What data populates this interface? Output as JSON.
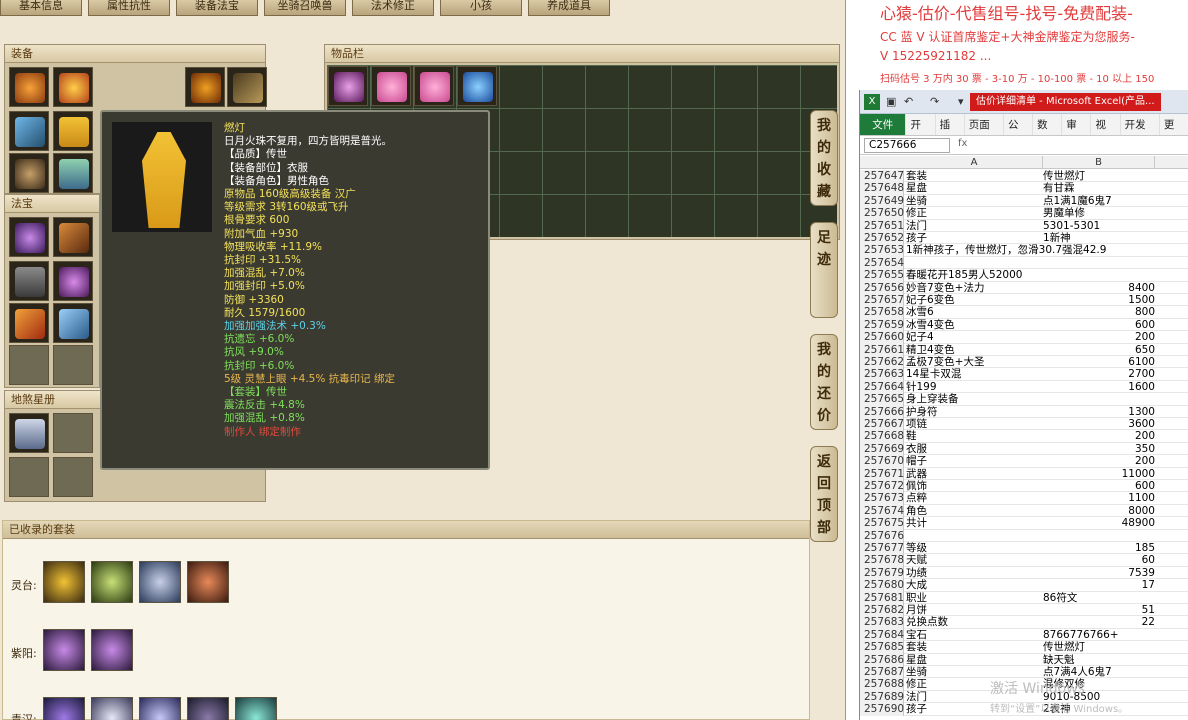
{
  "game": {
    "tabs": [
      "基本信息",
      "属性抗性",
      "装备法宝",
      "坐骑召唤兽",
      "法术修正",
      "小孩",
      "养成道具"
    ],
    "panels": {
      "equip": "装备",
      "fabao": "法宝",
      "stars": "地煞星册",
      "items": "物品栏",
      "collected": "已收录的套装"
    },
    "side_buttons": [
      [
        "我",
        "的",
        "收",
        "藏"
      ],
      [
        "足",
        "迹"
      ],
      [
        "我",
        "的",
        "还",
        "价"
      ],
      [
        "返",
        "回",
        "顶",
        "部"
      ]
    ],
    "collect_rows": [
      "灵台:",
      "紫阳:",
      "青汉:"
    ]
  },
  "tooltip": {
    "lines": [
      {
        "t": "燃灯",
        "c": "l-yellow"
      },
      {
        "t": "日月火珠不复用，四方皆明是普光。",
        "c": "l-white"
      },
      {
        "t": "【品质】传世",
        "c": "l-white"
      },
      {
        "t": "【装备部位】衣服",
        "c": "l-white"
      },
      {
        "t": "【装备角色】男性角色",
        "c": "l-white"
      },
      {
        "t": "原物品 160级高级装备 汉广",
        "c": "l-yellow"
      },
      {
        "t": "等级需求 3转160级或飞升",
        "c": "l-yellow"
      },
      {
        "t": "根骨要求 600",
        "c": "l-yellow"
      },
      {
        "t": "附加气血 +930",
        "c": "l-yellow"
      },
      {
        "t": "物理吸收率 +11.9%",
        "c": "l-yellow"
      },
      {
        "t": "抗封印 +31.5%",
        "c": "l-yellow"
      },
      {
        "t": "加强混乱 +7.0%",
        "c": "l-yellow"
      },
      {
        "t": "加强封印 +5.0%",
        "c": "l-yellow"
      },
      {
        "t": "防御 +3360",
        "c": "l-yellow"
      },
      {
        "t": "耐久 1579/1600",
        "c": "l-yellow"
      },
      {
        "t": "加强加强法术 +0.3%",
        "c": "l-cyan"
      },
      {
        "t": "抗遗忘 +6.0%",
        "c": "l-green"
      },
      {
        "t": "抗风 +9.0%",
        "c": "l-green"
      },
      {
        "t": "抗封印 +6.0%",
        "c": "l-green"
      },
      {
        "t": "5级 灵慧上眼 +4.5% 抗毒印记 绑定",
        "c": "l-gold"
      },
      {
        "t": " ",
        "c": "l-white"
      },
      {
        "t": "【套装】传世",
        "c": "l-green"
      },
      {
        "t": "震法反击 +4.8%",
        "c": "l-green"
      },
      {
        "t": "加强混乱 +0.8%",
        "c": "l-green"
      },
      {
        "t": "制作人 绑定制作",
        "c": "l-red"
      }
    ]
  },
  "right": {
    "ad": {
      "line1": "心猿-估价-代售组号-找号-免费配装-",
      "line2": "CC 蓝 V 认证首席鉴定+大神金牌鉴定为您服务-",
      "line3": "V 15225921182 ...",
      "line4": "扫码估号 3 万内 30 票 - 3-10 万 - 10-100 票 - 10 以上 150"
    },
    "excel": {
      "title": "估价详细清单 - Microsoft Excel(产品...",
      "tabs": [
        "文件",
        "开始",
        "插入",
        "页面布",
        "公式",
        "数据",
        "审阅",
        "视图",
        "开发工",
        "更多"
      ],
      "namebox": "C257666",
      "fx": "fx",
      "col_a": "A",
      "col_b": "B",
      "rows": [
        [
          "257647",
          "套装",
          "传世燃灯",
          false
        ],
        [
          "257648",
          "星盘",
          "有甘霖",
          false
        ],
        [
          "257649",
          "坐骑",
          "点1满1魔6鬼7",
          false
        ],
        [
          "257650",
          "修正",
          "男魔单修",
          false
        ],
        [
          "257651",
          "法门",
          "5301-5301",
          false
        ],
        [
          "257652",
          "孩子",
          "1新神",
          false
        ],
        [
          "257653",
          "1新神孩子，传世燃灯，忽滑30.7强混42.9",
          "",
          false
        ],
        [
          "257654",
          "",
          "",
          false
        ],
        [
          "257655",
          "春暖花开185男人52000",
          "",
          false
        ],
        [
          "257656",
          "妙音7变色+法力",
          "8400",
          true
        ],
        [
          "257657",
          "妃子6变色",
          "1500",
          true
        ],
        [
          "257658",
          "冰雪6",
          "800",
          true
        ],
        [
          "257659",
          "冰雪4变色",
          "600",
          true
        ],
        [
          "257660",
          "妃子4",
          "200",
          true
        ],
        [
          "257661",
          "精卫4变色",
          "650",
          true
        ],
        [
          "257662",
          "孟极7变色+大圣",
          "6100",
          true
        ],
        [
          "257663",
          "14星卡双混",
          "2700",
          true
        ],
        [
          "257664",
          "针199",
          "1600",
          true
        ],
        [
          "257665",
          "身上穿装备",
          "",
          false
        ],
        [
          "257666",
          "护身符",
          "1300",
          true
        ],
        [
          "257667",
          "项链",
          "3600",
          true
        ],
        [
          "257668",
          "鞋",
          "200",
          true
        ],
        [
          "257669",
          "衣服",
          "350",
          true
        ],
        [
          "257670",
          "帽子",
          "200",
          true
        ],
        [
          "257671",
          "武器",
          "11000",
          true
        ],
        [
          "257672",
          "佩饰",
          "600",
          true
        ],
        [
          "257673",
          "点粹",
          "1100",
          true
        ],
        [
          "257674",
          "角色",
          "8000",
          true
        ],
        [
          "257675",
          "共计",
          "48900",
          true
        ],
        [
          "257676",
          "",
          "",
          false
        ],
        [
          "257677",
          "等级",
          "185",
          true
        ],
        [
          "257678",
          "天赋",
          "60",
          true
        ],
        [
          "257679",
          "功绩",
          "7539",
          true
        ],
        [
          "257680",
          "大成",
          "17",
          true
        ],
        [
          "257681",
          "职业",
          "86符文",
          false
        ],
        [
          "257682",
          "月饼",
          "51",
          true
        ],
        [
          "257683",
          "兑换点数",
          "22",
          true
        ],
        [
          "257684",
          "宝石",
          "8766776766+",
          false
        ],
        [
          "257685",
          "套装",
          "传世燃灯",
          false
        ],
        [
          "257686",
          "星盘",
          "缺天魁",
          false
        ],
        [
          "257687",
          "坐骑",
          "点7满4人6鬼7",
          false
        ],
        [
          "257688",
          "修正",
          "混修双修",
          false
        ],
        [
          "257689",
          "法门",
          "9010-8500",
          false
        ],
        [
          "257690",
          "孩子",
          "2表神",
          false
        ]
      ]
    },
    "watermark1": "激活 Windows",
    "watermark2": "转到“设置”以激活 Windows。"
  }
}
